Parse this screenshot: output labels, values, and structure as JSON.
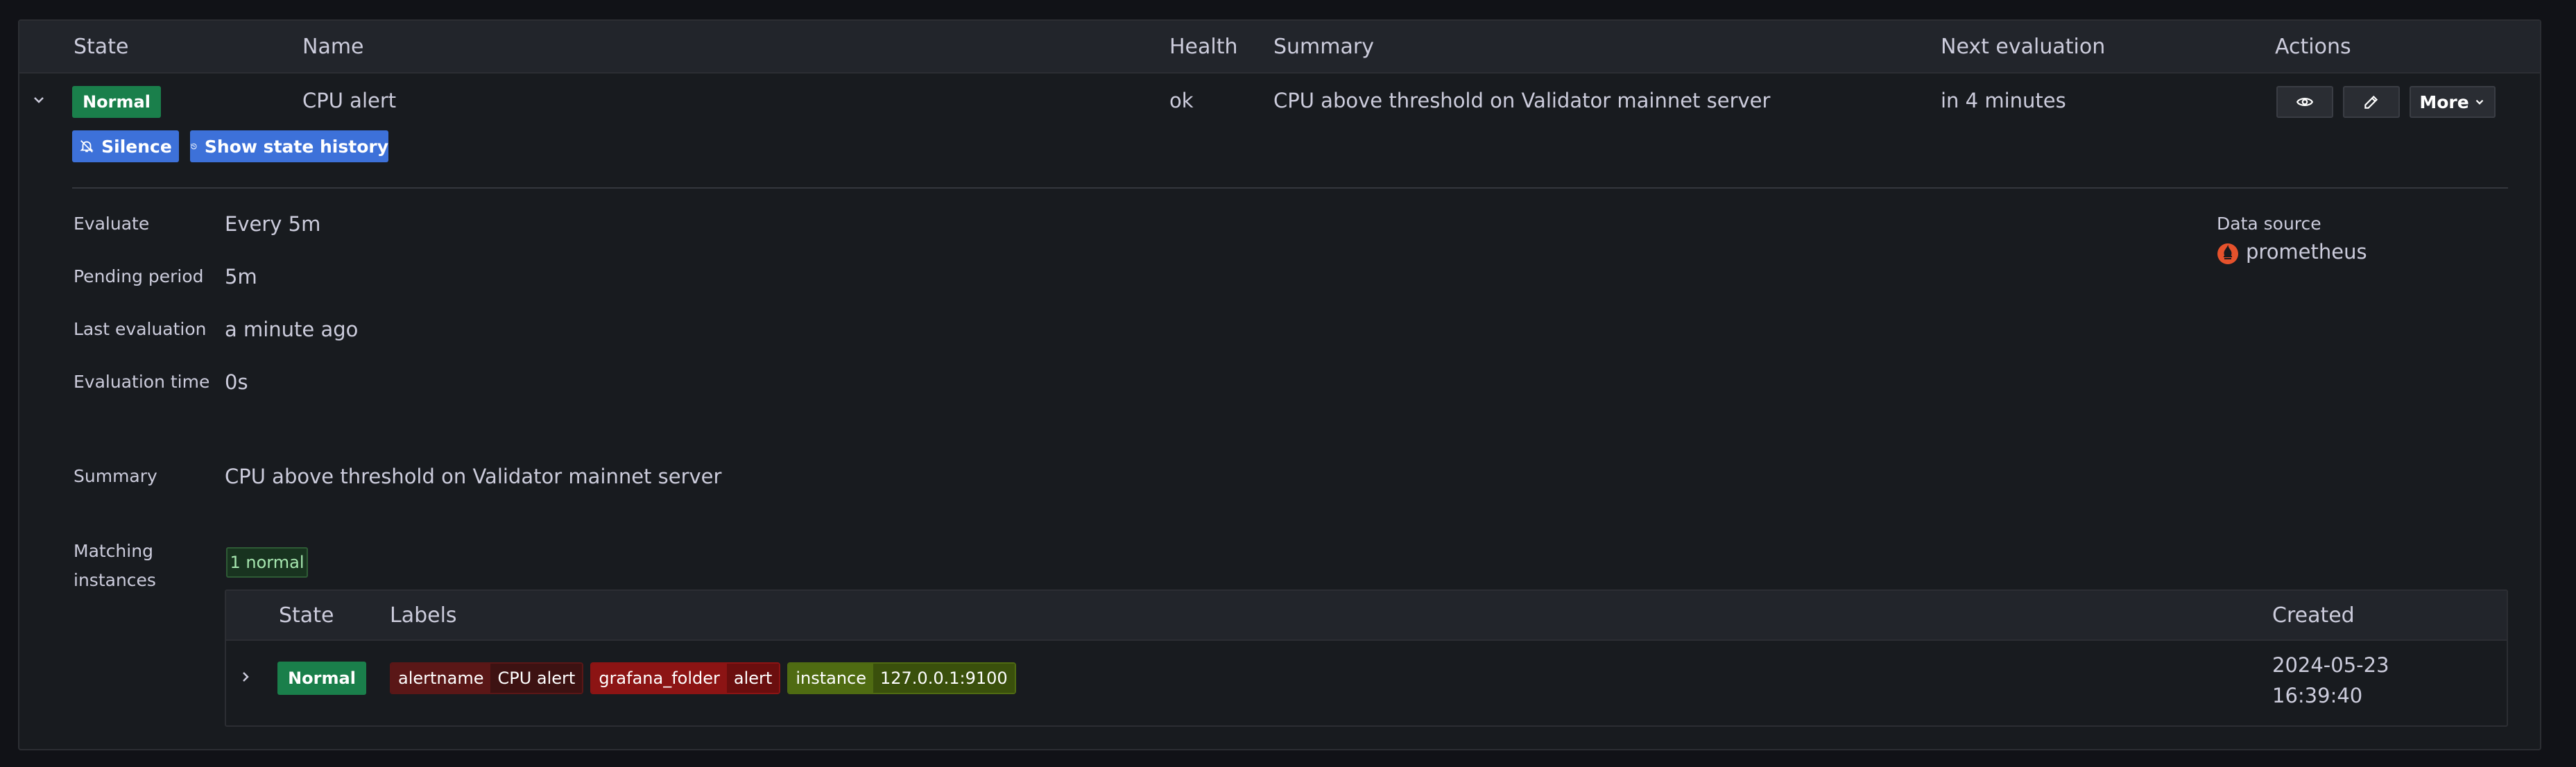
{
  "table": {
    "headers": {
      "state": "State",
      "name": "Name",
      "health": "Health",
      "summary": "Summary",
      "next_evaluation": "Next evaluation",
      "actions": "Actions"
    },
    "row": {
      "state": "Normal",
      "name": "CPU alert",
      "health": "ok",
      "summary": "CPU above threshold on Validator mainnet server",
      "next_evaluation": "in 4 minutes"
    },
    "actions": {
      "view_icon": "eye-icon",
      "edit_icon": "pencil-icon",
      "more_label": "More"
    }
  },
  "buttons": {
    "silence": "Silence",
    "state_history": "Show state history"
  },
  "details": {
    "evaluate_label": "Evaluate",
    "evaluate_value": "Every 5m",
    "pending_label": "Pending period",
    "pending_value": "5m",
    "last_eval_label": "Last evaluation",
    "last_eval_value": "a minute ago",
    "eval_time_label": "Evaluation time",
    "eval_time_value": "0s",
    "summary_label": "Summary",
    "summary_value": "CPU above threshold on Validator mainnet server",
    "matching_label_1": "Matching",
    "matching_label_2": "instances",
    "matching_count": "1 normal",
    "datasource_label": "Data source",
    "datasource_value": "prometheus"
  },
  "instances": {
    "headers": {
      "state": "State",
      "labels": "Labels",
      "created": "Created"
    },
    "row": {
      "state": "Normal",
      "labels": [
        {
          "key": "alertname",
          "value": "CPU alert"
        },
        {
          "key": "grafana_folder",
          "value": "alert"
        },
        {
          "key": "instance",
          "value": "127.0.0.1:9100"
        }
      ],
      "created_date": "2024-05-23",
      "created_time": "16:39:40"
    }
  },
  "colors": {
    "normal_green": "#1a7f4b",
    "primary_blue": "#3d71d9",
    "prometheus_orange": "#e6522c"
  }
}
